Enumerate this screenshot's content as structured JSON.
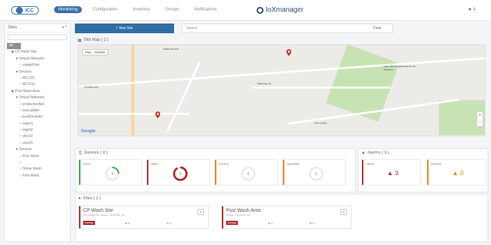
{
  "header": {
    "logo": "ICC",
    "nav": [
      "Monitoring",
      "Configuration",
      "Inventory",
      "Groups",
      "Notifications"
    ],
    "active_tab": "Monitoring",
    "brand": "IoXmanager",
    "user": "A"
  },
  "sidebar": {
    "title": "Sites",
    "toggle": "v ^",
    "items": [
      {
        "label": "All",
        "level": 0
      },
      {
        "label": "CP Wash Site",
        "level": 1
      },
      {
        "label": "Virtual Networks",
        "level": 2
      },
      {
        "label": "usageFlow",
        "level": 3
      },
      {
        "label": "Devices",
        "level": 2
      },
      {
        "label": "RF1231",
        "level": 3
      },
      {
        "label": "RF1210",
        "level": 3
      },
      {
        "label": "Post Wash Area",
        "level": 1
      },
      {
        "label": "Virtual Networks",
        "level": 2
      },
      {
        "label": "productionNet",
        "level": 3
      },
      {
        "label": "testLabNet",
        "level": 3
      },
      {
        "label": "postDockNet",
        "level": 3
      },
      {
        "label": "mgmt1",
        "level": 3
      },
      {
        "label": "mgmt2",
        "level": 3
      },
      {
        "label": "vlan10",
        "level": 3
      },
      {
        "label": "vlan20",
        "level": 3
      },
      {
        "label": "Devices",
        "level": 2
      },
      {
        "label": "Post Wash",
        "level": 3
      },
      {
        "label": "",
        "level": 3
      },
      {
        "label": "Home Wash",
        "level": 3
      },
      {
        "label": "Post Wash",
        "level": 3
      }
    ]
  },
  "toolbar": {
    "new_site": "+ New Site",
    "search_placeholder": "Search",
    "clear": "Clear"
  },
  "map": {
    "title": "Site Map ( 2 )",
    "controls": [
      "Map",
      "Satellite"
    ],
    "labels": [
      "Stanford Ave",
      "Kimball Ave",
      "Ramsey Dr",
      "Flat Creek",
      "Villa Sierra Apartments for Seniors"
    ],
    "footer": "Google"
  },
  "devices": {
    "title": "Devices ( 8 )",
    "cards": [
      {
        "label": "Online",
        "color": "#3aa84a",
        "count": "4"
      },
      {
        "label": "Offline",
        "color": "#b02a2a",
        "count": "4"
      },
      {
        "label": "Pending",
        "color": "#e38a1a",
        "count": "0"
      },
      {
        "label": "Upgrading",
        "color": "#e38a1a",
        "count": "0"
      }
    ]
  },
  "alarms": {
    "title": "Alarms ( 3 )",
    "cards": [
      {
        "label": "Critical",
        "color": "#b02a2a",
        "count": "3"
      },
      {
        "label": "Warning",
        "color": "#e38a1a",
        "count": "0"
      }
    ]
  },
  "sites": {
    "title": "Sites ( 2 )",
    "items": [
      {
        "name": "CP Wash Site",
        "addr": "500 Linden Rd, Fresno, CA 93720, US",
        "badge": "manage",
        "m1": "5",
        "m2": "4"
      },
      {
        "name": "Post Wash Area",
        "addr": "Fresno, CA 93720, US",
        "badge": "manage",
        "m1": "2",
        "m2": "5"
      }
    ]
  }
}
